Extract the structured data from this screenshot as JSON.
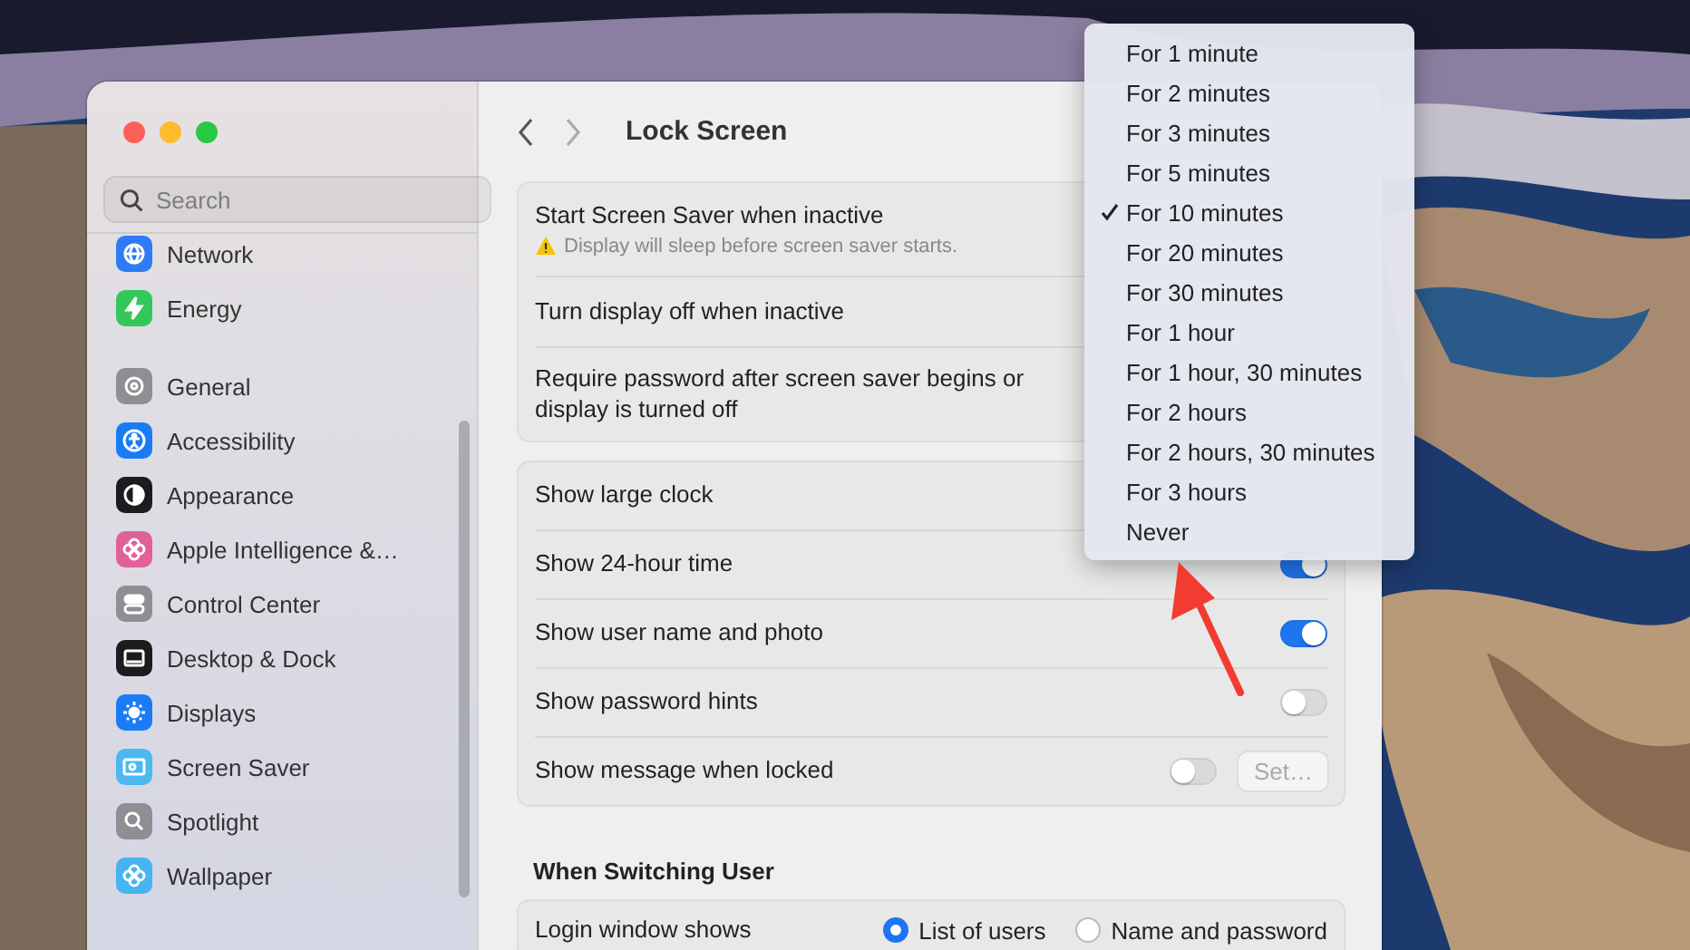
{
  "sidebar": {
    "search": {
      "placeholder": "Search"
    },
    "groups": [
      [
        {
          "label": "Network",
          "color": "#2f7bf5"
        },
        {
          "label": "Energy",
          "color": "#34c759"
        }
      ],
      [
        {
          "label": "General",
          "color": "#8e8e93"
        },
        {
          "label": "Accessibility",
          "color": "#1a7cf5"
        },
        {
          "label": "Appearance",
          "color": "#1c1c1e"
        },
        {
          "label": "Apple Intelligence &…",
          "color": "#e0609a"
        },
        {
          "label": "Control Center",
          "color": "#8e8e93"
        },
        {
          "label": "Desktop & Dock",
          "color": "#1c1c1e"
        },
        {
          "label": "Displays",
          "color": "#1a7cf5"
        },
        {
          "label": "Screen Saver",
          "color": "#4cb8f0"
        },
        {
          "label": "Spotlight",
          "color": "#8e8e93"
        },
        {
          "label": "Wallpaper",
          "color": "#45b4f0"
        }
      ]
    ]
  },
  "header": {
    "title": "Lock Screen"
  },
  "groups": [
    [
      {
        "kind": "text",
        "label": "Start Screen Saver when inactive",
        "warning": "Display will sleep before screen saver starts."
      },
      {
        "kind": "text",
        "label": "Turn display off when inactive"
      },
      {
        "kind": "text",
        "label": "Require password after screen saver begins or display is turned off"
      }
    ],
    [
      {
        "kind": "text",
        "label": "Show large clock"
      },
      {
        "kind": "toggle",
        "label": "Show 24-hour time",
        "on": true
      },
      {
        "kind": "toggle",
        "label": "Show user name and photo",
        "on": true
      },
      {
        "kind": "toggle",
        "label": "Show password hints",
        "on": false
      },
      {
        "kind": "toggle_button",
        "label": "Show message when locked",
        "on": false,
        "button": "Set…",
        "disabled": true
      }
    ]
  ],
  "switching": {
    "title": "When Switching User",
    "label": "Login window shows",
    "options": [
      {
        "label": "List of users",
        "selected": true
      },
      {
        "label": "Name and password",
        "selected": false
      }
    ]
  },
  "menu": [
    {
      "label": "For 1 minute",
      "selected": false
    },
    {
      "label": "For 2 minutes",
      "selected": false
    },
    {
      "label": "For 3 minutes",
      "selected": false
    },
    {
      "label": "For 5 minutes",
      "selected": false
    },
    {
      "label": "For 10 minutes",
      "selected": true
    },
    {
      "label": "For 20 minutes",
      "selected": false
    },
    {
      "label": "For 30 minutes",
      "selected": false
    },
    {
      "label": "For 1 hour",
      "selected": false
    },
    {
      "label": "For 1 hour, 30 minutes",
      "selected": false
    },
    {
      "label": "For 2 hours",
      "selected": false
    },
    {
      "label": "For 2 hours, 30 minutes",
      "selected": false
    },
    {
      "label": "For 3 hours",
      "selected": false
    },
    {
      "label": "Never",
      "selected": false
    }
  ]
}
